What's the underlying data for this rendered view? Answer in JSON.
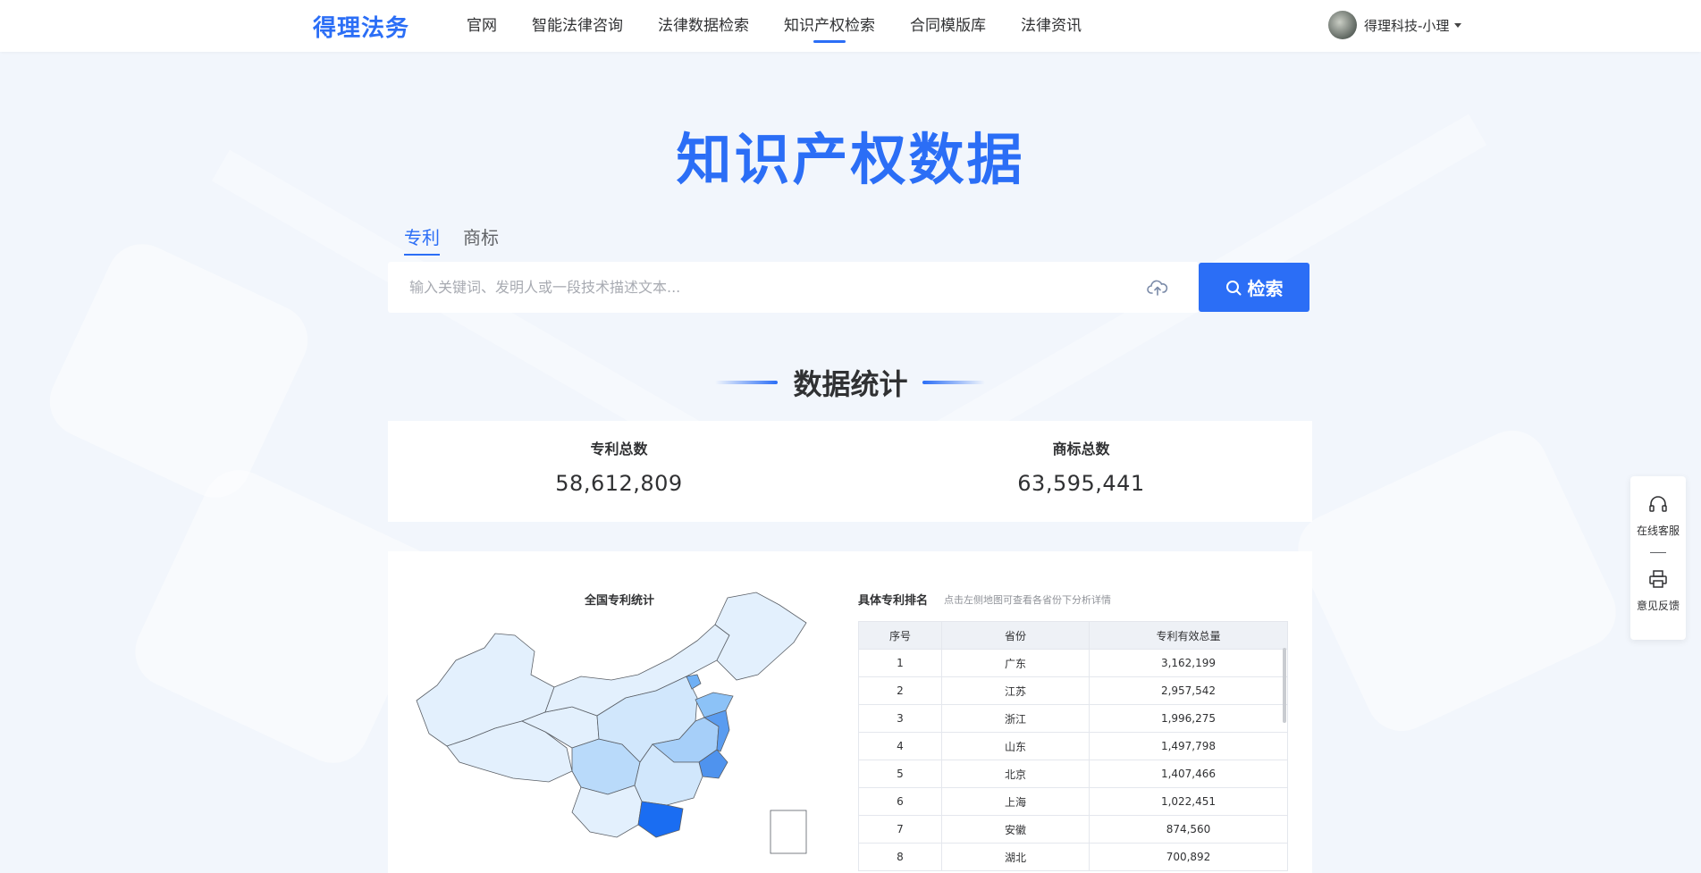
{
  "nav": {
    "logo": "得理法务",
    "items": [
      "官网",
      "智能法律咨询",
      "法律数据检索",
      "知识产权检索",
      "合同模版库",
      "法律资讯"
    ],
    "active_index": 3,
    "user_name": "得理科技-小理"
  },
  "hero": {
    "title": "知识产权数据",
    "tabs": [
      "专利",
      "商标"
    ],
    "active_tab": 0,
    "search_placeholder": "输入关键词、发明人或一段技术描述文本...",
    "search_button": "检索"
  },
  "stats": {
    "section_title": "数据统计",
    "patent_label": "专利总数",
    "patent_value": "58,612,809",
    "trademark_label": "商标总数",
    "trademark_value": "63,595,441"
  },
  "map": {
    "title": "全国专利统计"
  },
  "ranking": {
    "title": "具体专利排名",
    "hint": "点击左侧地图可查看各省份下分析详情",
    "headers": [
      "序号",
      "省份",
      "专利有效总量"
    ],
    "rows": [
      [
        "1",
        "广东",
        "3,162,199"
      ],
      [
        "2",
        "江苏",
        "2,957,542"
      ],
      [
        "3",
        "浙江",
        "1,996,275"
      ],
      [
        "4",
        "山东",
        "1,497,798"
      ],
      [
        "5",
        "北京",
        "1,407,466"
      ],
      [
        "6",
        "上海",
        "1,022,451"
      ],
      [
        "7",
        "安徽",
        "874,560"
      ],
      [
        "8",
        "湖北",
        "700,892"
      ]
    ]
  },
  "float_bar": {
    "service": "在线客服",
    "feedback": "意见反馈"
  },
  "colors": {
    "primary": "#2b6ef6",
    "page_bg": "#f2f6fc"
  }
}
